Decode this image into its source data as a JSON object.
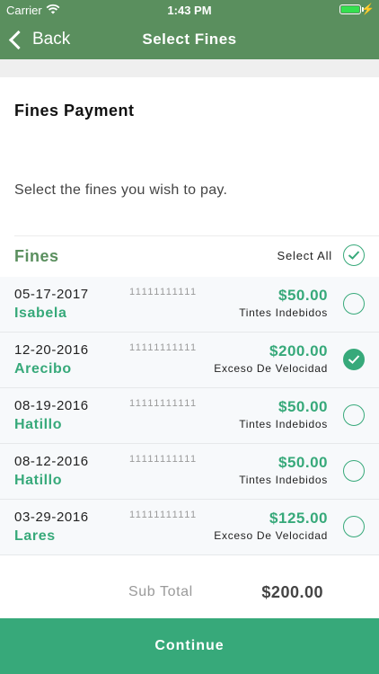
{
  "status_bar": {
    "carrier": "Carrier",
    "time": "1:43 PM"
  },
  "nav": {
    "back_label": "Back",
    "title": "Select Fines"
  },
  "card": {
    "title": "Fines Payment",
    "instruction": "Select the fines you wish to pay."
  },
  "fines_header": {
    "heading": "Fines",
    "select_all": "Select All"
  },
  "fines": [
    {
      "date": "05-17-2017",
      "town": "Isabela",
      "ref": "11111111111",
      "amount": "$50.00",
      "reason": "Tintes Indebidos",
      "selected": false
    },
    {
      "date": "12-20-2016",
      "town": "Arecibo",
      "ref": "11111111111",
      "amount": "$200.00",
      "reason": "Exceso De Velocidad",
      "selected": true
    },
    {
      "date": "08-19-2016",
      "town": "Hatillo",
      "ref": "11111111111",
      "amount": "$50.00",
      "reason": "Tintes Indebidos",
      "selected": false
    },
    {
      "date": "08-12-2016",
      "town": "Hatillo",
      "ref": "11111111111",
      "amount": "$50.00",
      "reason": "Tintes Indebidos",
      "selected": false
    },
    {
      "date": "03-29-2016",
      "town": "Lares",
      "ref": "11111111111",
      "amount": "$125.00",
      "reason": "Exceso De Velocidad",
      "selected": false
    }
  ],
  "subtotal": {
    "label": "Sub Total",
    "value": "$200.00"
  },
  "continue_label": "Continue",
  "colors": {
    "nav_green": "#5a8f5e",
    "accent_green": "#37a97a"
  },
  "icons": {
    "back": "chevron-left-icon",
    "check": "checkmark-circle-icon",
    "wifi": "wifi-icon",
    "battery": "battery-icon"
  }
}
